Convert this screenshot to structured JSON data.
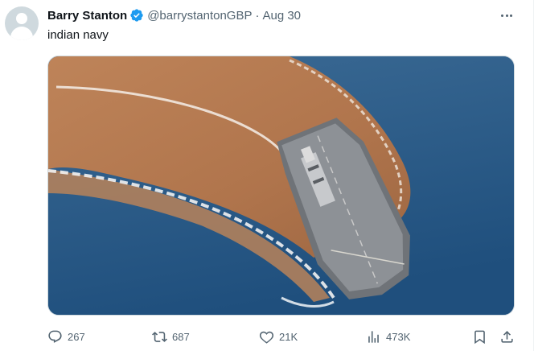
{
  "author": {
    "name": "Barry Stanton",
    "handle": "@barrystantonGBP",
    "separator": "·",
    "date": "Aug 30",
    "verified_color": "#1d9bf0"
  },
  "tweet": {
    "text": "indian navy"
  },
  "media": {
    "subject": "aircraft carrier turning at sea leaving a brown wake"
  },
  "actions": {
    "replies": "267",
    "reposts": "687",
    "likes": "21K",
    "views": "473K"
  },
  "icons": [
    "more-icon",
    "verified-badge-icon",
    "reply-icon",
    "repost-icon",
    "like-icon",
    "views-icon",
    "bookmark-icon",
    "share-icon"
  ],
  "colors": {
    "text_primary": "#0f1419",
    "text_secondary": "#536471",
    "accent": "#1d9bf0"
  }
}
